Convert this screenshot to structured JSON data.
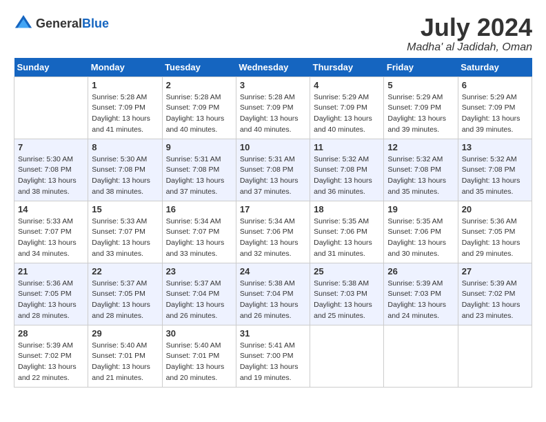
{
  "header": {
    "logo_general": "General",
    "logo_blue": "Blue",
    "title": "July 2024",
    "subtitle": "Madha' al Jadidah, Oman"
  },
  "calendar": {
    "weekdays": [
      "Sunday",
      "Monday",
      "Tuesday",
      "Wednesday",
      "Thursday",
      "Friday",
      "Saturday"
    ],
    "rows": [
      [
        {
          "day": "",
          "info": ""
        },
        {
          "day": "1",
          "info": "Sunrise: 5:28 AM\nSunset: 7:09 PM\nDaylight: 13 hours\nand 41 minutes."
        },
        {
          "day": "2",
          "info": "Sunrise: 5:28 AM\nSunset: 7:09 PM\nDaylight: 13 hours\nand 40 minutes."
        },
        {
          "day": "3",
          "info": "Sunrise: 5:28 AM\nSunset: 7:09 PM\nDaylight: 13 hours\nand 40 minutes."
        },
        {
          "day": "4",
          "info": "Sunrise: 5:29 AM\nSunset: 7:09 PM\nDaylight: 13 hours\nand 40 minutes."
        },
        {
          "day": "5",
          "info": "Sunrise: 5:29 AM\nSunset: 7:09 PM\nDaylight: 13 hours\nand 39 minutes."
        },
        {
          "day": "6",
          "info": "Sunrise: 5:29 AM\nSunset: 7:09 PM\nDaylight: 13 hours\nand 39 minutes."
        }
      ],
      [
        {
          "day": "7",
          "info": "Sunrise: 5:30 AM\nSunset: 7:08 PM\nDaylight: 13 hours\nand 38 minutes."
        },
        {
          "day": "8",
          "info": "Sunrise: 5:30 AM\nSunset: 7:08 PM\nDaylight: 13 hours\nand 38 minutes."
        },
        {
          "day": "9",
          "info": "Sunrise: 5:31 AM\nSunset: 7:08 PM\nDaylight: 13 hours\nand 37 minutes."
        },
        {
          "day": "10",
          "info": "Sunrise: 5:31 AM\nSunset: 7:08 PM\nDaylight: 13 hours\nand 37 minutes."
        },
        {
          "day": "11",
          "info": "Sunrise: 5:32 AM\nSunset: 7:08 PM\nDaylight: 13 hours\nand 36 minutes."
        },
        {
          "day": "12",
          "info": "Sunrise: 5:32 AM\nSunset: 7:08 PM\nDaylight: 13 hours\nand 35 minutes."
        },
        {
          "day": "13",
          "info": "Sunrise: 5:32 AM\nSunset: 7:08 PM\nDaylight: 13 hours\nand 35 minutes."
        }
      ],
      [
        {
          "day": "14",
          "info": "Sunrise: 5:33 AM\nSunset: 7:07 PM\nDaylight: 13 hours\nand 34 minutes."
        },
        {
          "day": "15",
          "info": "Sunrise: 5:33 AM\nSunset: 7:07 PM\nDaylight: 13 hours\nand 33 minutes."
        },
        {
          "day": "16",
          "info": "Sunrise: 5:34 AM\nSunset: 7:07 PM\nDaylight: 13 hours\nand 33 minutes."
        },
        {
          "day": "17",
          "info": "Sunrise: 5:34 AM\nSunset: 7:06 PM\nDaylight: 13 hours\nand 32 minutes."
        },
        {
          "day": "18",
          "info": "Sunrise: 5:35 AM\nSunset: 7:06 PM\nDaylight: 13 hours\nand 31 minutes."
        },
        {
          "day": "19",
          "info": "Sunrise: 5:35 AM\nSunset: 7:06 PM\nDaylight: 13 hours\nand 30 minutes."
        },
        {
          "day": "20",
          "info": "Sunrise: 5:36 AM\nSunset: 7:05 PM\nDaylight: 13 hours\nand 29 minutes."
        }
      ],
      [
        {
          "day": "21",
          "info": "Sunrise: 5:36 AM\nSunset: 7:05 PM\nDaylight: 13 hours\nand 28 minutes."
        },
        {
          "day": "22",
          "info": "Sunrise: 5:37 AM\nSunset: 7:05 PM\nDaylight: 13 hours\nand 28 minutes."
        },
        {
          "day": "23",
          "info": "Sunrise: 5:37 AM\nSunset: 7:04 PM\nDaylight: 13 hours\nand 26 minutes."
        },
        {
          "day": "24",
          "info": "Sunrise: 5:38 AM\nSunset: 7:04 PM\nDaylight: 13 hours\nand 26 minutes."
        },
        {
          "day": "25",
          "info": "Sunrise: 5:38 AM\nSunset: 7:03 PM\nDaylight: 13 hours\nand 25 minutes."
        },
        {
          "day": "26",
          "info": "Sunrise: 5:39 AM\nSunset: 7:03 PM\nDaylight: 13 hours\nand 24 minutes."
        },
        {
          "day": "27",
          "info": "Sunrise: 5:39 AM\nSunset: 7:02 PM\nDaylight: 13 hours\nand 23 minutes."
        }
      ],
      [
        {
          "day": "28",
          "info": "Sunrise: 5:39 AM\nSunset: 7:02 PM\nDaylight: 13 hours\nand 22 minutes."
        },
        {
          "day": "29",
          "info": "Sunrise: 5:40 AM\nSunset: 7:01 PM\nDaylight: 13 hours\nand 21 minutes."
        },
        {
          "day": "30",
          "info": "Sunrise: 5:40 AM\nSunset: 7:01 PM\nDaylight: 13 hours\nand 20 minutes."
        },
        {
          "day": "31",
          "info": "Sunrise: 5:41 AM\nSunset: 7:00 PM\nDaylight: 13 hours\nand 19 minutes."
        },
        {
          "day": "",
          "info": ""
        },
        {
          "day": "",
          "info": ""
        },
        {
          "day": "",
          "info": ""
        }
      ]
    ]
  }
}
